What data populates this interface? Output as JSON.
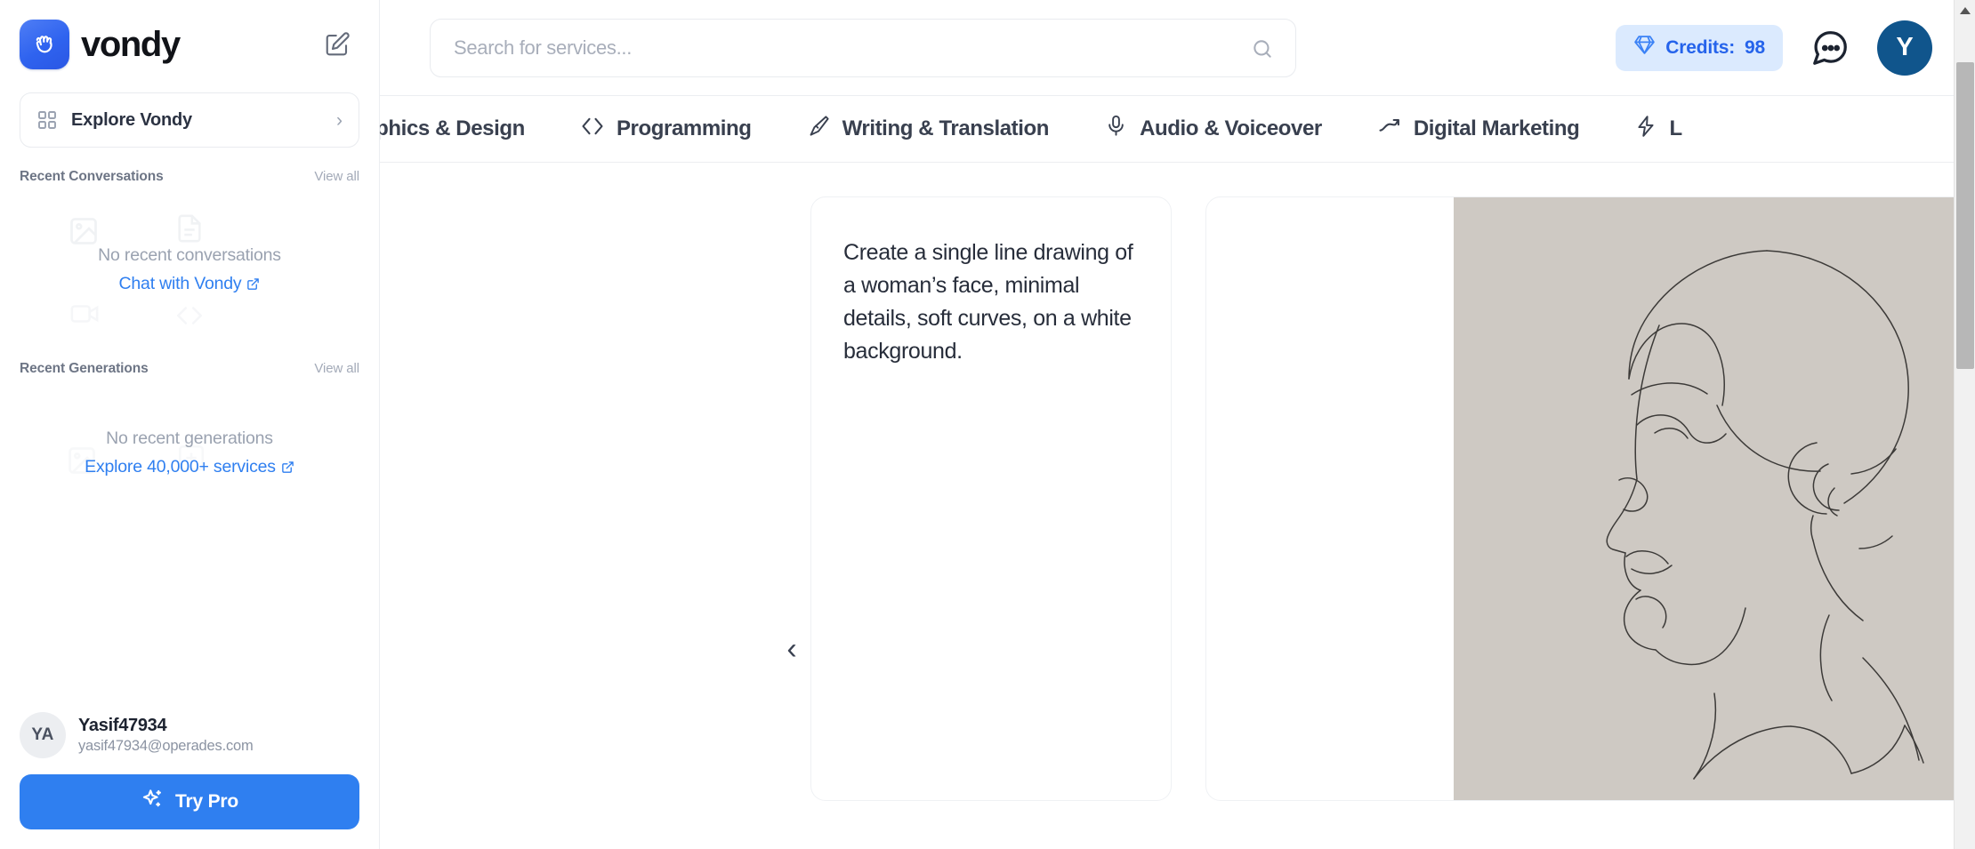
{
  "sidebar": {
    "brand": {
      "name": "vondy",
      "logo_icon": "shaka-hand-logo-icon"
    },
    "compose_icon": "compose-edit-icon",
    "explore": {
      "label": "Explore Vondy",
      "icon": "grid-apps-icon",
      "chevron": "›"
    },
    "conversations": {
      "title": "Recent Conversations",
      "view_all": "View all",
      "empty_text": "No recent conversations",
      "empty_link": "Chat with Vondy"
    },
    "generations": {
      "title": "Recent Generations",
      "view_all": "View all",
      "empty_text": "No recent generations",
      "empty_link": "Explore 40,000+ services"
    },
    "user": {
      "initials": "YA",
      "name": "Yasif47934",
      "email": "yasif47934@operades.com"
    },
    "try_pro": {
      "label": "Try Pro",
      "icon": "sparkles-icon"
    }
  },
  "header": {
    "search": {
      "placeholder": "Search for services...",
      "value": "",
      "icon": "search-icon"
    },
    "credits": {
      "label": "Credits:",
      "value": "98",
      "icon": "diamond-icon",
      "color": "#2563eb",
      "bg": "#dbeafe"
    },
    "chat_icon": "chat-bubble-dots-icon",
    "avatar": {
      "initial": "Y",
      "color": "#10558c"
    }
  },
  "tabs": [
    {
      "label": "Graphics & Design",
      "icon": "palette-icon"
    },
    {
      "label": "Programming",
      "icon": "code-brackets-icon"
    },
    {
      "label": "Writing & Translation",
      "icon": "pen-nib-icon"
    },
    {
      "label": "Audio & Voiceover",
      "icon": "microphone-icon"
    },
    {
      "label": "Digital Marketing",
      "icon": "trend-arrow-icon"
    },
    {
      "label": "L",
      "icon": "lightning-bolt-icon"
    }
  ],
  "content": {
    "carousel_prev": "‹",
    "prompt": "Create a single line drawing of a woman’s face, minimal details, soft curves, on a white background.",
    "image": {
      "alt": "single line drawing of a woman's face in profile",
      "background": "#cec9c3",
      "download_icon": "download-icon"
    }
  },
  "scrollbar": {
    "up_arrow": "scroll-up-arrow-icon"
  }
}
